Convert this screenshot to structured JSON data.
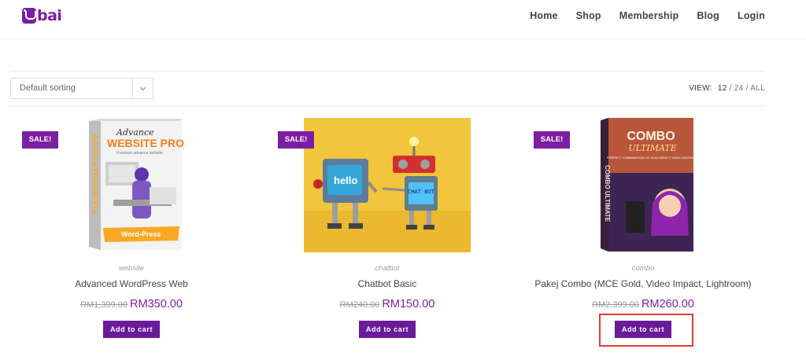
{
  "header": {
    "logo_text": "bai",
    "nav": [
      "Home",
      "Shop",
      "Membership",
      "Blog",
      "Login"
    ]
  },
  "toolbar": {
    "sort_value": "Default sorting",
    "view_label": "VIEW:",
    "view_options": [
      "12",
      "24",
      "ALL"
    ],
    "view_sep": "/"
  },
  "products": [
    {
      "sale_badge": "SALE!",
      "category": "website",
      "name": "Advanced WordPress Web",
      "old_price": "RM1,399.00",
      "price": "RM350.00",
      "button": "Add to cart",
      "box_title_1": "Advance",
      "box_title_2": "WEBSITE PRO",
      "box_sub": "Premium advance website",
      "box_side": "Advance Website Pro",
      "box_footer": "Word-Press"
    },
    {
      "sale_badge": "SALE!",
      "category": "chatbot",
      "name": "Chatbot Basic",
      "old_price": "RM240.00",
      "price": "RM150.00",
      "button": "Add to cart",
      "robot1_screen": "hello",
      "robot2_screen": "CHAT BOT"
    },
    {
      "sale_badge": "SALE!",
      "category": "combo",
      "name": "Pakej Combo (MCE Gold, Video Impact, Lightroom)",
      "old_price": "RM2,399.00",
      "price": "RM260.00",
      "button": "Add to cart",
      "box_title_1": "COMBO",
      "box_title_2": "ULTIMATE",
      "box_sub": "PERFECT COMBINATION OF HIGH IMPACT VIDEO EDITING",
      "box_side": "COMBO ULTIMATE"
    }
  ],
  "colors": {
    "brand": "#7b1fa2",
    "button": "#6a1b9a",
    "highlight": "#e53935"
  }
}
